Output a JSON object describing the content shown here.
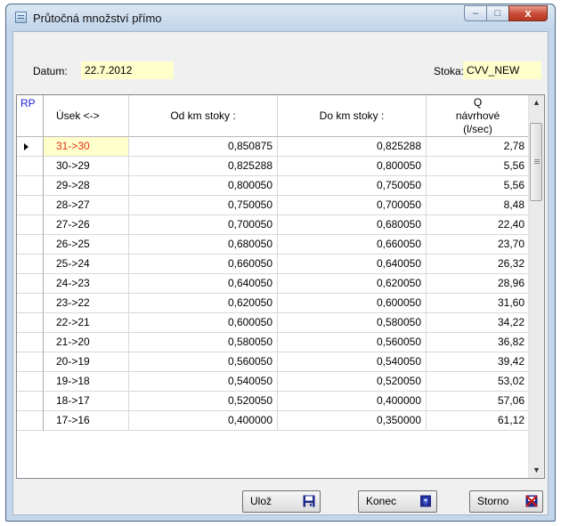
{
  "window": {
    "title": "Průtočná množství přímo",
    "minimize": "–",
    "maximize": "□",
    "close": "x"
  },
  "header": {
    "datum_label": "Datum:",
    "datum_value": "22.7.2012",
    "stoka_label": "Stoka:",
    "stoka_value": "CVV_NEW"
  },
  "grid": {
    "row_header_label": "RP",
    "columns": [
      "Úsek <->",
      "Od km stoky :",
      "Do km stoky :",
      "Q návrhové (l/sec)"
    ],
    "rows": [
      [
        "31->30",
        "0,850875",
        "0,825288",
        "2,78"
      ],
      [
        "30->29",
        "0,825288",
        "0,800050",
        "5,56"
      ],
      [
        "29->28",
        "0,800050",
        "0,750050",
        "5,56"
      ],
      [
        "28->27",
        "0,750050",
        "0,700050",
        "8,48"
      ],
      [
        "27->26",
        "0,700050",
        "0,680050",
        "22,40"
      ],
      [
        "26->25",
        "0,680050",
        "0,660050",
        "23,70"
      ],
      [
        "25->24",
        "0,660050",
        "0,640050",
        "26,32"
      ],
      [
        "24->23",
        "0,640050",
        "0,620050",
        "28,96"
      ],
      [
        "23->22",
        "0,620050",
        "0,600050",
        "31,60"
      ],
      [
        "22->21",
        "0,600050",
        "0,580050",
        "34,22"
      ],
      [
        "21->20",
        "0,580050",
        "0,560050",
        "36,82"
      ],
      [
        "20->19",
        "0,560050",
        "0,540050",
        "39,42"
      ],
      [
        "19->18",
        "0,540050",
        "0,520050",
        "53,02"
      ],
      [
        "18->17",
        "0,520050",
        "0,400000",
        "57,06"
      ],
      [
        "17->16",
        "0,400000",
        "0,350000",
        "61,12"
      ]
    ],
    "selected_row": 0,
    "scroll_up": "▲",
    "scroll_down": "▼"
  },
  "buttons": {
    "save": "Ulož",
    "close": "Konec",
    "cancel": "Storno"
  },
  "colors": {
    "field_bg": "#ffffcc",
    "selected_text": "#e53017",
    "rp_text": "#1e1ed8",
    "save_icon": "#1f2a8a",
    "close_icon": "#1f2a8a",
    "cancel_icon": "#c81818"
  },
  "icons": {
    "save": "floppy-disk-icon",
    "close": "exit-door-icon",
    "cancel": "cancel-cross-icon"
  }
}
